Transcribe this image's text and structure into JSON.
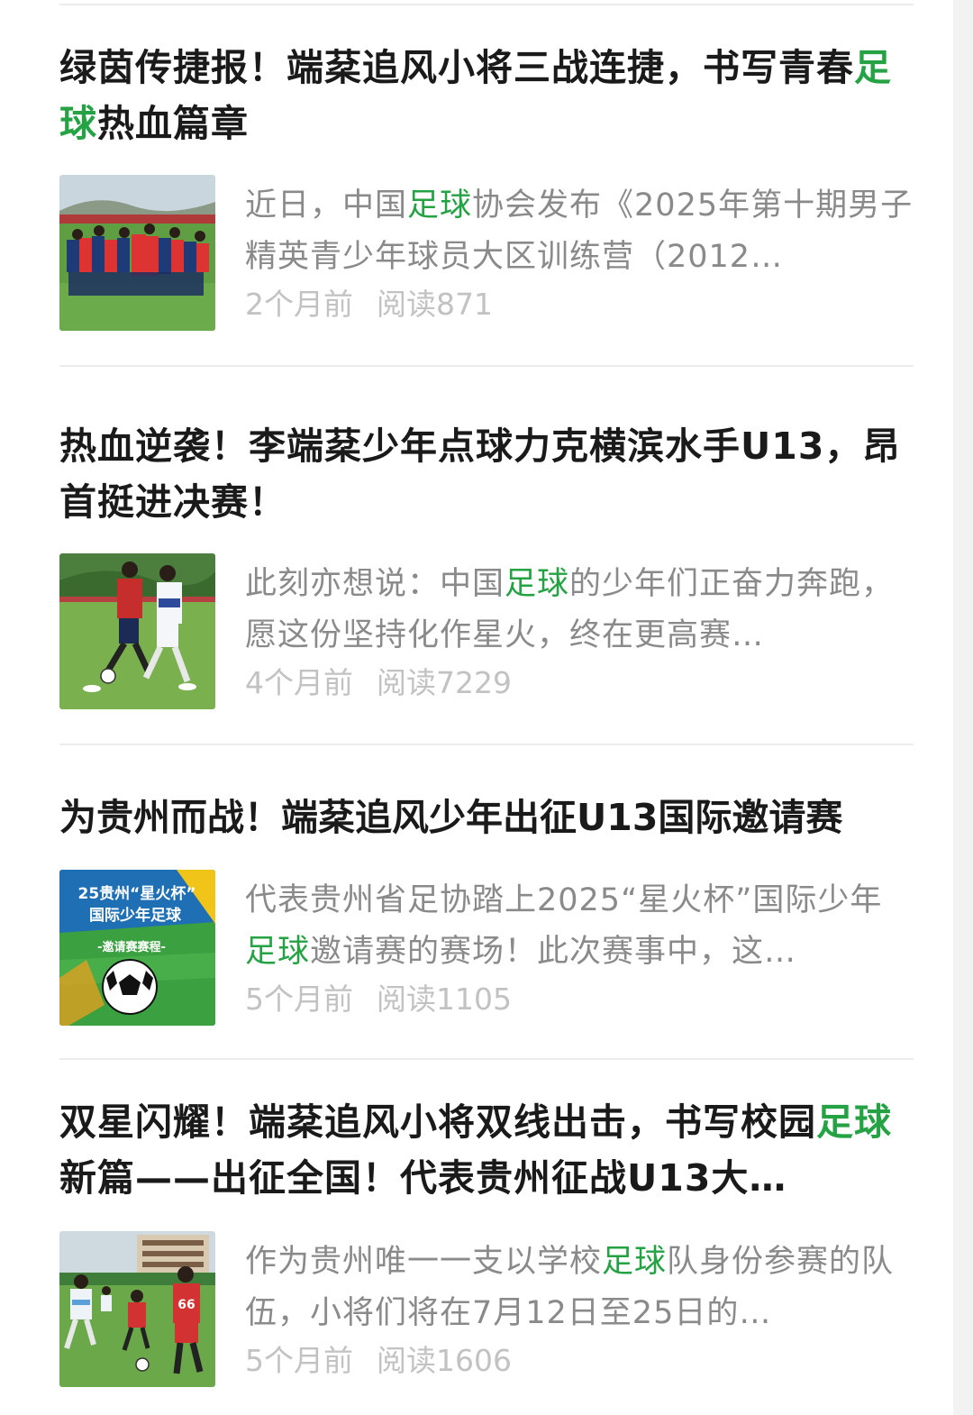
{
  "articles": [
    {
      "title_parts": [
        "绿茵传捷报！端棻追风小将三战连捷，书写青春",
        "足球",
        "热血篇章"
      ],
      "summary_parts": [
        "近日，中国",
        "足球",
        "协会发布《2025年第十期男子精英青少年球员大区训练营（2012…"
      ],
      "time": "2个月前",
      "reads": "阅读871"
    },
    {
      "title_parts": [
        "热血逆袭！李端棻少年点球力克横滨水手U13，昂首挺进决赛！",
        "",
        ""
      ],
      "summary_parts": [
        "此刻亦想说：中国",
        "足球",
        "的少年们正奋力奔跑，愿这份坚持化作星火，终在更高赛…"
      ],
      "time": "4个月前",
      "reads": "阅读7229"
    },
    {
      "title_parts": [
        "为贵州而战！端棻追风少年出征U13国际邀请赛",
        "",
        ""
      ],
      "summary_parts": [
        "代表贵州省足协踏上2025“星火杯”国际少年",
        "足球",
        "邀请赛的赛场！此次赛事中，这…"
      ],
      "thumb_text": [
        "25贵州“星火杯”",
        "国际少年足球",
        "-邀请赛赛程-"
      ],
      "time": "5个月前",
      "reads": "阅读1105"
    },
    {
      "title_parts": [
        "双星闪耀！端棻追风小将双线出击，书写校园",
        "足球",
        "新篇——出征全国！代表贵州征战U13大…"
      ],
      "summary_parts": [
        "作为贵州唯一一支以学校",
        "足球",
        "队身份参赛的队伍，小将们将在7月12日至25日的…"
      ],
      "time": "5个月前",
      "reads": "阅读1606"
    }
  ],
  "colors": {
    "highlight": "#25a244",
    "title": "#1a1a1a",
    "summary": "#8a8a8a",
    "meta": "#c2c2c2"
  }
}
